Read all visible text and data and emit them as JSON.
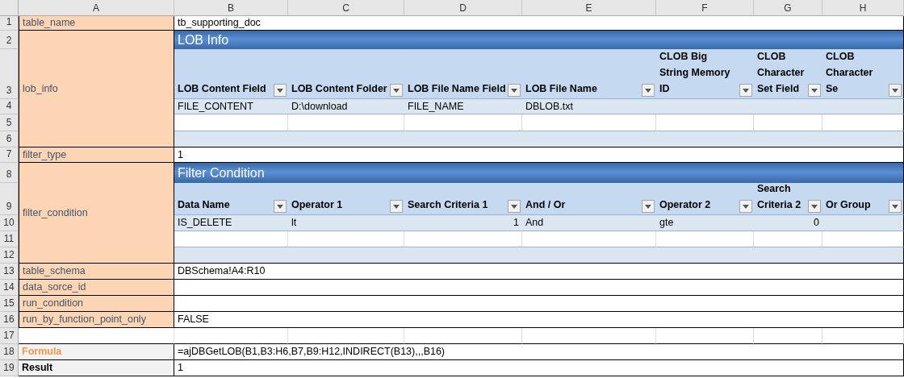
{
  "column_letters": [
    "A",
    "B",
    "C",
    "D",
    "E",
    "F",
    "G",
    "H"
  ],
  "row_numbers": [
    "1",
    "2",
    "3",
    "4",
    "5",
    "6",
    "7",
    "8",
    "9",
    "10",
    "11",
    "12",
    "13",
    "14",
    "15",
    "16",
    "17",
    "18",
    "19"
  ],
  "fields": [
    {
      "kind": "text",
      "label": "table_name",
      "value": "tb_supporting_doc"
    },
    {
      "kind": "table",
      "label": "lob_info",
      "title": "LOB Info",
      "columns": [
        "LOB Content Field",
        "LOB Content Folder",
        "LOB File Name Field",
        "LOB File Name",
        "CLOB Big String Memory ID",
        "CLOB Character Set Field",
        "CLOB Character Se"
      ],
      "rows": [
        {
          "cells": [
            {
              "text": "FILE_CONTENT"
            },
            {
              "text": "D:\\download"
            },
            {
              "text": "FILE_NAME"
            },
            {
              "text": "DBLOB.txt"
            }
          ]
        }
      ]
    },
    {
      "kind": "text",
      "label": "filter_type",
      "value": "1"
    },
    {
      "kind": "table",
      "label": "filter_condition",
      "title": "Filter Condition",
      "columns": [
        "Data Name",
        "Operator 1",
        "Search Criteria 1",
        "And / Or",
        "Operator 2",
        "Search Criteria 2",
        "Or Group"
      ],
      "rows": [
        {
          "cells": [
            {
              "text": "IS_DELETE"
            },
            {
              "text": "lt"
            },
            {
              "text": "1",
              "kind": "number"
            },
            {
              "text": "And"
            },
            {
              "text": "gte"
            },
            {
              "text": "0",
              "kind": "number"
            }
          ]
        }
      ]
    },
    {
      "kind": "text",
      "label": "table_schema",
      "value": "DBSchema!A4:R10"
    },
    {
      "kind": "text",
      "label": "data_sorce_id"
    },
    {
      "kind": "text",
      "label": "run_condition"
    },
    {
      "kind": "text",
      "label": "run_by_function_point_only",
      "value": "FALSE"
    }
  ],
  "formula": {
    "label": "Formula",
    "value": "=ajDBGetLOB(B1,B3:H6,B7,B9:H12,INDIRECT(B13),,,B16)"
  },
  "result": {
    "label": "Result",
    "value": "1"
  }
}
